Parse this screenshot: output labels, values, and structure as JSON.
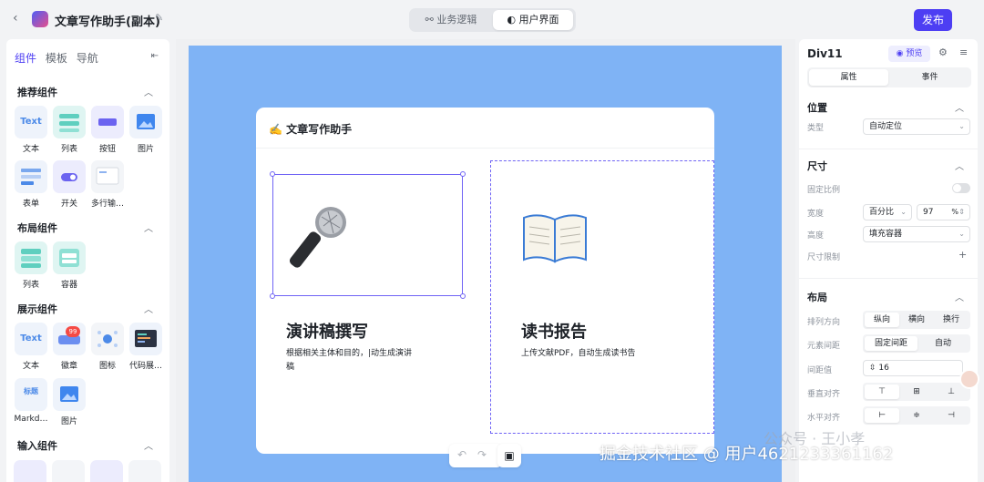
{
  "header": {
    "app_title": "文章写作助手(副本)",
    "mode_tabs": [
      "业务逻辑",
      "用户界面"
    ],
    "publish_label": "发布"
  },
  "left_panel": {
    "tabs": [
      "组件",
      "模板",
      "导航"
    ],
    "sections": [
      {
        "title": "推荐组件",
        "items": [
          "文本",
          "列表",
          "按钮",
          "图片",
          "表单",
          "开关",
          "多行输…"
        ]
      },
      {
        "title": "布局组件",
        "items": [
          "列表",
          "容器"
        ]
      },
      {
        "title": "展示组件",
        "items": [
          "文本",
          "徽章",
          "图标",
          "代码展…",
          "Markd…",
          "图片"
        ]
      },
      {
        "title": "输入组件",
        "items": []
      }
    ],
    "tile_text_glyph": "Text",
    "badge_count": "99",
    "markdown_glyph": "标题"
  },
  "canvas": {
    "card_title": "✍️ 文章写作助手",
    "features": [
      {
        "emoji": "🎤",
        "title": "演讲稿撰写",
        "desc": "根据相关主体和目的，|动生成演讲稿"
      },
      {
        "emoji": "📖",
        "title": "读书报告",
        "desc": "上传文献PDF，自动生成读书告"
      }
    ]
  },
  "right_panel": {
    "component_name": "Div11",
    "preview_label": "预览",
    "tabs": [
      "属性",
      "事件"
    ],
    "position_section": "位置",
    "type_label": "类型",
    "type_value": "自动定位",
    "size_section": "尺寸",
    "fixed_ratio_label": "固定比例",
    "width_label": "宽度",
    "width_unit": "百分比",
    "width_value": "97",
    "width_suffix": "%",
    "height_label": "高度",
    "height_value": "填充容器",
    "size_limit_label": "尺寸限制",
    "layout_section": "布局",
    "direction_label": "排列方向",
    "direction_options": [
      "纵向",
      "横向",
      "换行"
    ],
    "spacing_label": "元素间距",
    "spacing_options": [
      "固定间距",
      "自动"
    ],
    "gap_label": "间距值",
    "gap_value": "16",
    "valign_label": "垂直对齐",
    "halign_label": "水平对齐"
  },
  "watermark": "掘金技术社区 @ 用户4621233361162",
  "watermark2": "公众号 · 王小孝"
}
